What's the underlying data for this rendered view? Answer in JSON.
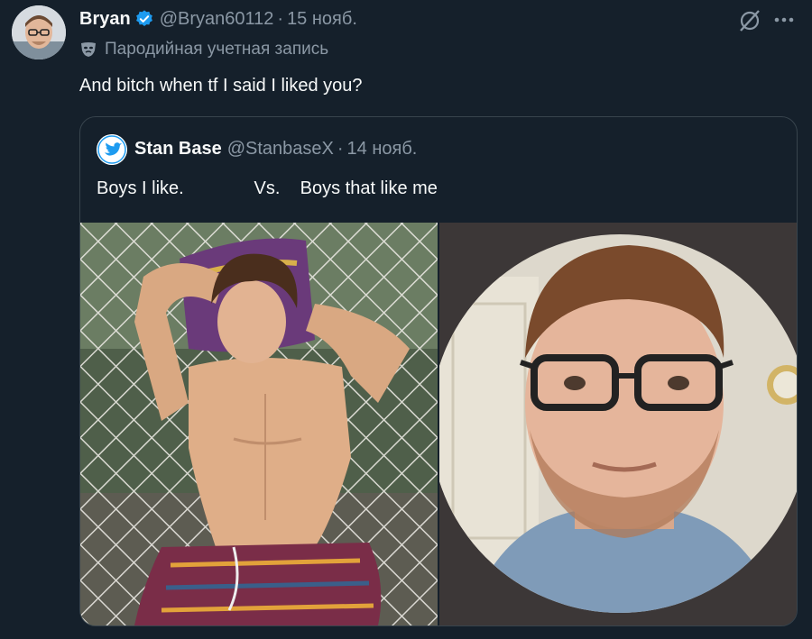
{
  "author": {
    "name": "Bryan",
    "handle": "@Bryan60112",
    "separator": "·",
    "date": "15 нояб.",
    "label": "Пародийная учетная запись",
    "verified_color": "#1d9bf0"
  },
  "tweet": {
    "text": "And bitch when tf I said I liked you?"
  },
  "quote": {
    "name": "Stan Base",
    "handle": "@StanbaseX",
    "separator": "·",
    "date": "14 нояб.",
    "text": "Boys I like.              Vs.    Boys that like me"
  },
  "icons": {
    "grok": "grok-icon",
    "more": "more-icon",
    "parody": "mask-icon"
  },
  "colors": {
    "background": "#15202b",
    "secondary_text": "#8b98a5",
    "border": "#38444d",
    "accent": "#1d9bf0"
  }
}
